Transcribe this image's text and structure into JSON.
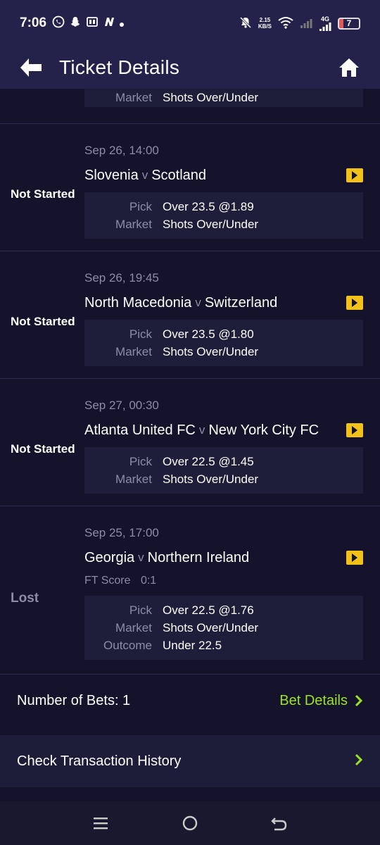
{
  "status_bar": {
    "time": "7:06",
    "net_speed_value": "2.15",
    "net_speed_unit": "KB/S",
    "network_type": "4G",
    "battery": "7"
  },
  "header": {
    "title": "Ticket Details"
  },
  "partial": {
    "market_label": "Market",
    "market_value": "Shots Over/Under"
  },
  "bets": [
    {
      "status": "Not Started",
      "date": "Sep 26, 14:00",
      "home": "Slovenia",
      "vs": "v",
      "away": "Scotland",
      "pick_label": "Pick",
      "pick_value": "Over 23.5 @1.89",
      "market_label": "Market",
      "market_value": "Shots Over/Under"
    },
    {
      "status": "Not Started",
      "date": "Sep 26, 19:45",
      "home": "North Macedonia",
      "vs": "v",
      "away": "Switzerland",
      "pick_label": "Pick",
      "pick_value": "Over 23.5 @1.80",
      "market_label": "Market",
      "market_value": "Shots Over/Under"
    },
    {
      "status": "Not Started",
      "date": "Sep 27, 00:30",
      "home": "Atlanta United FC",
      "vs": "v",
      "away": "New York City FC",
      "pick_label": "Pick",
      "pick_value": "Over 22.5 @1.45",
      "market_label": "Market",
      "market_value": "Shots Over/Under"
    },
    {
      "status": "Lost",
      "date": "Sep 25, 17:00",
      "home": "Georgia",
      "vs": "v",
      "away": "Northern Ireland",
      "ft_label": "FT Score",
      "ft_value": "0:1",
      "pick_label": "Pick",
      "pick_value": "Over 22.5 @1.76",
      "market_label": "Market",
      "market_value": "Shots Over/Under",
      "outcome_label": "Outcome",
      "outcome_value": "Under 22.5"
    }
  ],
  "summary": {
    "num_bets": "Number of Bets: 1",
    "bet_details": "Bet Details"
  },
  "history": {
    "label": "Check Transaction History"
  },
  "icons": {
    "back": "arrow-left-icon",
    "home": "home-icon",
    "match": "play-arrow-icon",
    "chevron": "chevron-right-icon"
  },
  "colors": {
    "background": "#14132b",
    "header": "#24224a",
    "accent_green": "#9be225",
    "icon_yellow": "#f2c21b",
    "muted_text": "#8d8ca6"
  }
}
